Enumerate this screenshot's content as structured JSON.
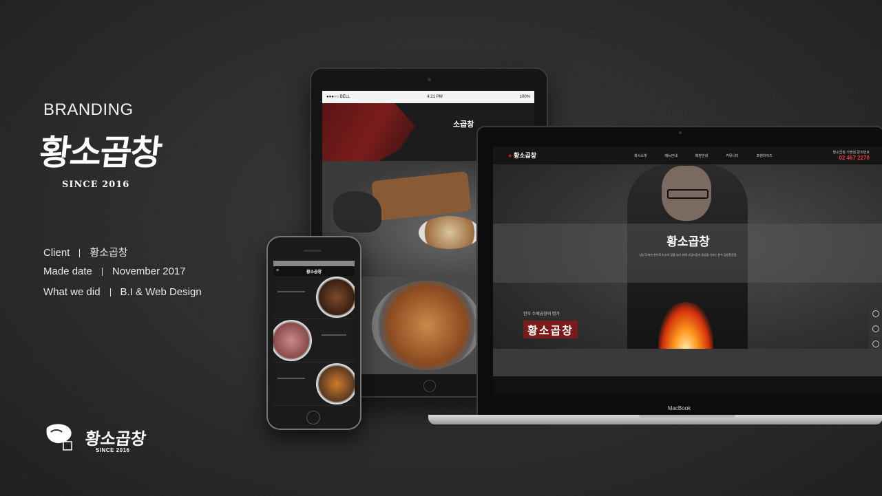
{
  "left_panel": {
    "heading": "BRANDING",
    "logo_text": "황소곱창",
    "since": "SINCE 2016",
    "info": [
      {
        "label": "Client",
        "value": "황소곱창"
      },
      {
        "label": "Made date",
        "value": "November 2017"
      },
      {
        "label": "What we did",
        "value": "B.I  & Web Design"
      }
    ],
    "footer_logo_text": "황소곱창",
    "footer_since": "SINCE 2016"
  },
  "tablet": {
    "status_left": "●●●○○ BELL",
    "status_time": "4:21 PM",
    "status_right": "100%",
    "hero_title": "소곱창"
  },
  "laptop": {
    "brand": "황소곱창",
    "nav_items": [
      "회사소개",
      "메뉴안내",
      "매장안내",
      "커뮤니티",
      "프랜차이즈"
    ],
    "phone_label": "황소곱창 가맹점 문의번호",
    "phone_number": "02 467 2270",
    "hero_title": "황소곱창",
    "hero_desc": "싱싱 도축한 한우로 최고의 맛을 내기 위해 고집스럽게 정성을 다하는 한우 곱창전문점",
    "tag_small": "한우 수제곱창의 명가",
    "tag_big": "황소곱창",
    "macbook_label": "MacBook"
  },
  "phone": {
    "logo": "황소곱창"
  }
}
